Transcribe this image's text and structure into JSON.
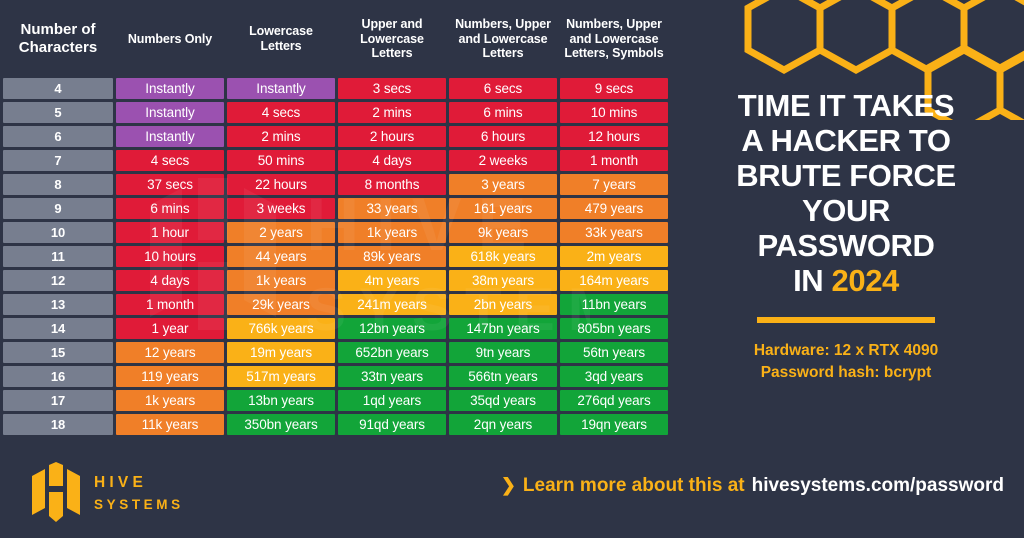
{
  "background_color": "#2e3446",
  "accent_color": "#fab117",
  "headline": {
    "line1": "TIME IT TAKES",
    "line2": "A HACKER TO",
    "line3": "BRUTE FORCE",
    "line4": "YOUR",
    "line5": "PASSWORD",
    "line6_prefix": "IN ",
    "line6_year": "2024"
  },
  "spec": {
    "hardware": "Hardware: 12 x RTX 4090",
    "hash": "Password hash: bcrypt"
  },
  "footer": {
    "logo_line1": "HIVE",
    "logo_line2": "SYSTEMS",
    "chevron": "❯",
    "learn_lead": "Learn more about this at",
    "learn_url": "hivesystems.com/password"
  },
  "watermark_text": "HIVE SYSTEMS",
  "legend_colors": {
    "instant": "#9b51b0",
    "very_fast": "#e01b38",
    "fast": "#f07f28",
    "medium": "#fab117",
    "safe": "#12a539",
    "row_label": "#777e8f"
  },
  "chart_data": {
    "type": "table",
    "title": "TIME IT TAKES A HACKER TO BRUTE FORCE YOUR PASSWORD IN 2024",
    "columns": [
      "Number of Characters",
      "Numbers Only",
      "Lowercase Letters",
      "Upper and Lowercase Letters",
      "Numbers, Upper and Lowercase Letters",
      "Numbers, Upper and Lowercase Letters, Symbols"
    ],
    "column_header_lines": [
      [
        "Number of",
        "Characters"
      ],
      [
        "Numbers Only"
      ],
      [
        "Lowercase",
        "Letters"
      ],
      [
        "Upper and",
        "Lowercase",
        "Letters"
      ],
      [
        "Numbers, Upper",
        "and Lowercase",
        "Letters"
      ],
      [
        "Numbers, Upper",
        "and Lowercase",
        "Letters, Symbols"
      ]
    ],
    "rows": [
      {
        "chars": "4",
        "cells": [
          {
            "text": "Instantly",
            "color": "#9b51b0"
          },
          {
            "text": "Instantly",
            "color": "#9b51b0"
          },
          {
            "text": "3 secs",
            "color": "#e01b38"
          },
          {
            "text": "6 secs",
            "color": "#e01b38"
          },
          {
            "text": "9 secs",
            "color": "#e01b38"
          }
        ]
      },
      {
        "chars": "5",
        "cells": [
          {
            "text": "Instantly",
            "color": "#9b51b0"
          },
          {
            "text": "4 secs",
            "color": "#e01b38"
          },
          {
            "text": "2 mins",
            "color": "#e01b38"
          },
          {
            "text": "6 mins",
            "color": "#e01b38"
          },
          {
            "text": "10 mins",
            "color": "#e01b38"
          }
        ]
      },
      {
        "chars": "6",
        "cells": [
          {
            "text": "Instantly",
            "color": "#9b51b0"
          },
          {
            "text": "2 mins",
            "color": "#e01b38"
          },
          {
            "text": "2 hours",
            "color": "#e01b38"
          },
          {
            "text": "6 hours",
            "color": "#e01b38"
          },
          {
            "text": "12 hours",
            "color": "#e01b38"
          }
        ]
      },
      {
        "chars": "7",
        "cells": [
          {
            "text": "4 secs",
            "color": "#e01b38"
          },
          {
            "text": "50 mins",
            "color": "#e01b38"
          },
          {
            "text": "4 days",
            "color": "#e01b38"
          },
          {
            "text": "2 weeks",
            "color": "#e01b38"
          },
          {
            "text": "1 month",
            "color": "#e01b38"
          }
        ]
      },
      {
        "chars": "8",
        "cells": [
          {
            "text": "37 secs",
            "color": "#e01b38"
          },
          {
            "text": "22 hours",
            "color": "#e01b38"
          },
          {
            "text": "8 months",
            "color": "#e01b38"
          },
          {
            "text": "3 years",
            "color": "#f07f28"
          },
          {
            "text": "7 years",
            "color": "#f07f28"
          }
        ]
      },
      {
        "chars": "9",
        "cells": [
          {
            "text": "6 mins",
            "color": "#e01b38"
          },
          {
            "text": "3 weeks",
            "color": "#e01b38"
          },
          {
            "text": "33 years",
            "color": "#f07f28"
          },
          {
            "text": "161 years",
            "color": "#f07f28"
          },
          {
            "text": "479 years",
            "color": "#f07f28"
          }
        ]
      },
      {
        "chars": "10",
        "cells": [
          {
            "text": "1 hour",
            "color": "#e01b38"
          },
          {
            "text": "2 years",
            "color": "#f07f28"
          },
          {
            "text": "1k years",
            "color": "#f07f28"
          },
          {
            "text": "9k years",
            "color": "#f07f28"
          },
          {
            "text": "33k years",
            "color": "#f07f28"
          }
        ]
      },
      {
        "chars": "11",
        "cells": [
          {
            "text": "10 hours",
            "color": "#e01b38"
          },
          {
            "text": "44 years",
            "color": "#f07f28"
          },
          {
            "text": "89k years",
            "color": "#f07f28"
          },
          {
            "text": "618k years",
            "color": "#fab117"
          },
          {
            "text": "2m years",
            "color": "#fab117"
          }
        ]
      },
      {
        "chars": "12",
        "cells": [
          {
            "text": "4 days",
            "color": "#e01b38"
          },
          {
            "text": "1k years",
            "color": "#f07f28"
          },
          {
            "text": "4m years",
            "color": "#fab117"
          },
          {
            "text": "38m years",
            "color": "#fab117"
          },
          {
            "text": "164m years",
            "color": "#fab117"
          }
        ]
      },
      {
        "chars": "13",
        "cells": [
          {
            "text": "1 month",
            "color": "#e01b38"
          },
          {
            "text": "29k years",
            "color": "#f07f28"
          },
          {
            "text": "241m years",
            "color": "#fab117"
          },
          {
            "text": "2bn years",
            "color": "#fab117"
          },
          {
            "text": "11bn years",
            "color": "#12a539"
          }
        ]
      },
      {
        "chars": "14",
        "cells": [
          {
            "text": "1 year",
            "color": "#e01b38"
          },
          {
            "text": "766k years",
            "color": "#fab117"
          },
          {
            "text": "12bn years",
            "color": "#12a539"
          },
          {
            "text": "147bn years",
            "color": "#12a539"
          },
          {
            "text": "805bn years",
            "color": "#12a539"
          }
        ]
      },
      {
        "chars": "15",
        "cells": [
          {
            "text": "12 years",
            "color": "#f07f28"
          },
          {
            "text": "19m years",
            "color": "#fab117"
          },
          {
            "text": "652bn years",
            "color": "#12a539"
          },
          {
            "text": "9tn years",
            "color": "#12a539"
          },
          {
            "text": "56tn years",
            "color": "#12a539"
          }
        ]
      },
      {
        "chars": "16",
        "cells": [
          {
            "text": "119 years",
            "color": "#f07f28"
          },
          {
            "text": "517m years",
            "color": "#fab117"
          },
          {
            "text": "33tn years",
            "color": "#12a539"
          },
          {
            "text": "566tn years",
            "color": "#12a539"
          },
          {
            "text": "3qd years",
            "color": "#12a539"
          }
        ]
      },
      {
        "chars": "17",
        "cells": [
          {
            "text": "1k years",
            "color": "#f07f28"
          },
          {
            "text": "13bn years",
            "color": "#12a539"
          },
          {
            "text": "1qd years",
            "color": "#12a539"
          },
          {
            "text": "35qd years",
            "color": "#12a539"
          },
          {
            "text": "276qd years",
            "color": "#12a539"
          }
        ]
      },
      {
        "chars": "18",
        "cells": [
          {
            "text": "11k years",
            "color": "#f07f28"
          },
          {
            "text": "350bn years",
            "color": "#12a539"
          },
          {
            "text": "91qd years",
            "color": "#12a539"
          },
          {
            "text": "2qn years",
            "color": "#12a539"
          },
          {
            "text": "19qn years",
            "color": "#12a539"
          }
        ]
      }
    ]
  }
}
